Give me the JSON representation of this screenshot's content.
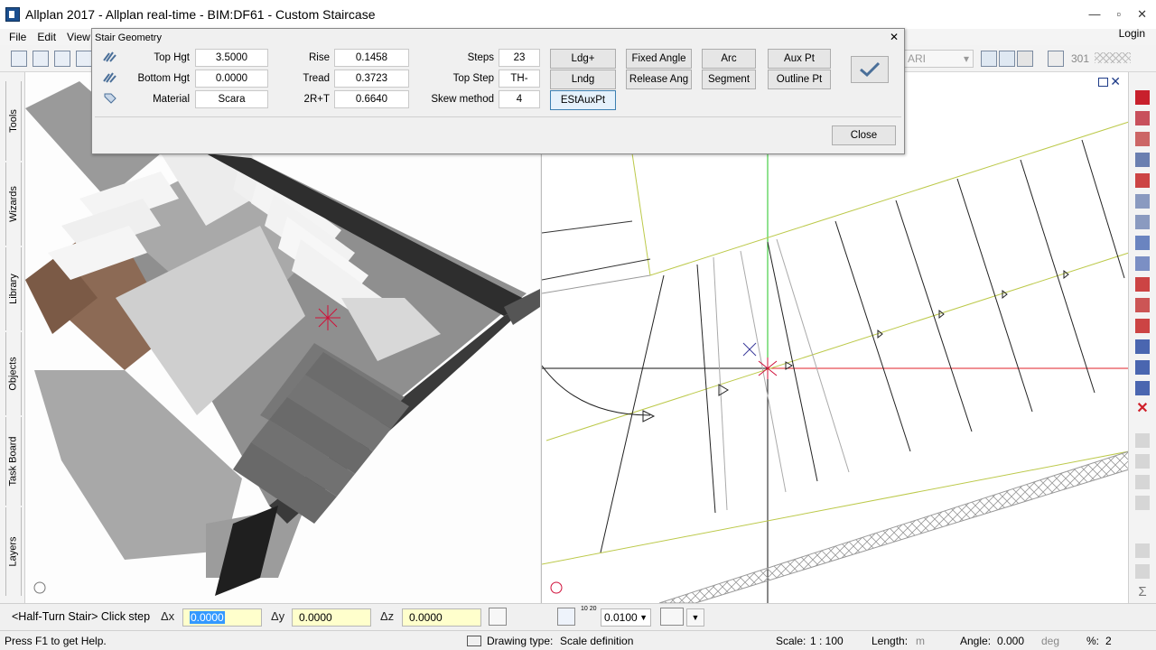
{
  "window": {
    "title": "Allplan 2017 - Allplan real-time - BIM:DF61 - Custom Staircase",
    "login": "Login"
  },
  "menu": {
    "file": "File",
    "edit": "Edit",
    "view": "View"
  },
  "toolbar": {
    "layer_field": "ARI",
    "pen_value": "301"
  },
  "left_tabs": [
    "Tools",
    "Wizards",
    "Library",
    "Objects",
    "Task Board",
    "Layers"
  ],
  "dialog": {
    "title": "Stair Geometry",
    "top_hgt_label": "Top Hgt",
    "top_hgt": "3.5000",
    "bottom_hgt_label": "Bottom Hgt",
    "bottom_hgt": "0.0000",
    "material_label": "Material",
    "material": "Scara",
    "rise_label": "Rise",
    "rise": "0.1458",
    "tread_label": "Tread",
    "tread": "0.3723",
    "two_r_t_label": "2R+T",
    "two_r_t": "0.6640",
    "steps_label": "Steps",
    "steps": "23",
    "top_step_label": "Top Step",
    "top_step": "TH-",
    "skew_label": "Skew method",
    "skew": "4",
    "buttons": {
      "ldg_plus": "Ldg+",
      "lndg": "Lndg",
      "estauxpt": "EStAuxPt",
      "fixed_angle": "Fixed Angle",
      "release_ang": "Release Ang",
      "arc": "Arc",
      "segment": "Segment",
      "aux_pt": "Aux Pt",
      "outline_pt": "Outline Pt"
    },
    "close": "Close"
  },
  "input": {
    "prompt": "<Half-Turn Stair> Click step",
    "dx_label": "Δx",
    "dx": "0.0000",
    "dy_label": "Δy",
    "dy": "0.0000",
    "dz_label": "Δz",
    "dz": "0.0000",
    "step_value": "0.0100",
    "step_icon_text": "10 20"
  },
  "status": {
    "help": "Press F1 to get Help.",
    "drawing_type_label": "Drawing type:",
    "drawing_type": "Scale definition",
    "scale_label": "Scale:",
    "scale": "1 : 100",
    "length_label": "Length:",
    "length_unit": "m",
    "angle_label": "Angle:",
    "angle": "0.000",
    "angle_unit": "deg",
    "pct_label": "%:",
    "pct": "2"
  },
  "colors": {
    "x_axis": "#e0202a",
    "y_axis": "#22c422",
    "stair_outline": "#bcc94a",
    "accent": "#3399ff",
    "input_bg": "#ffffcc"
  }
}
